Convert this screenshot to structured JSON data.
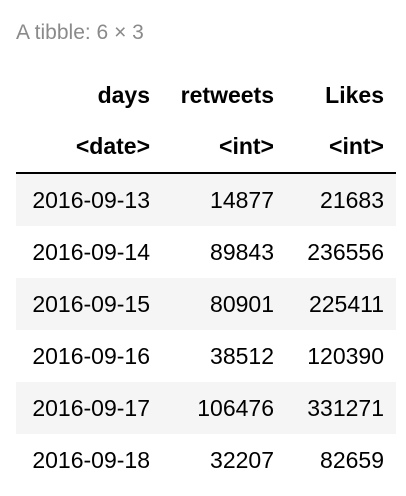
{
  "caption": "A tibble: 6 × 3",
  "columns": [
    {
      "name": "days",
      "type": "<date>"
    },
    {
      "name": "retweets",
      "type": "<int>"
    },
    {
      "name": "Likes",
      "type": "<int>"
    }
  ],
  "rows": [
    [
      "2016-09-13",
      "14877",
      "21683"
    ],
    [
      "2016-09-14",
      "89843",
      "236556"
    ],
    [
      "2016-09-15",
      "80901",
      "225411"
    ],
    [
      "2016-09-16",
      "38512",
      "120390"
    ],
    [
      "2016-09-17",
      "106476",
      "331271"
    ],
    [
      "2016-09-18",
      "32207",
      "82659"
    ]
  ],
  "colors": {
    "caption_text": "#8a8a8a",
    "stripe": "#f5f5f5",
    "header_rule": "#000000"
  }
}
